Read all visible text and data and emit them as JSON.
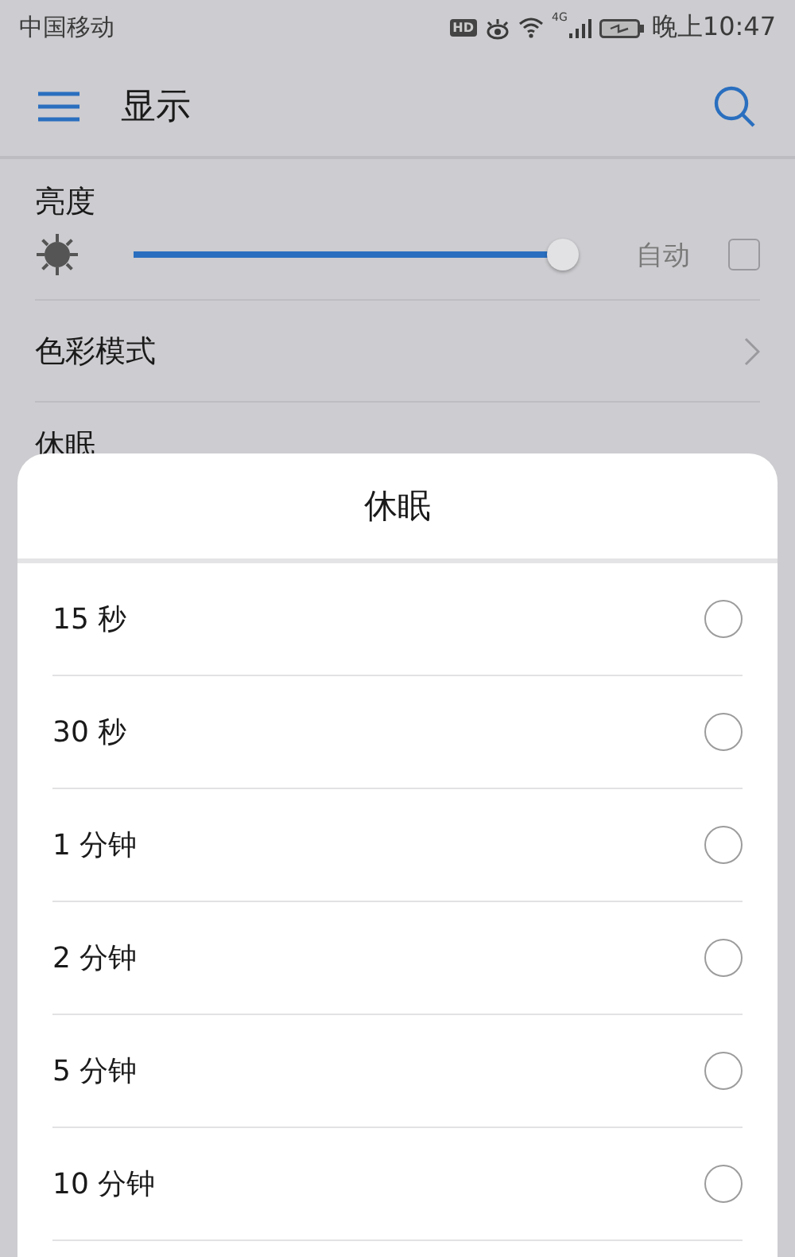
{
  "status_bar": {
    "carrier": "中国移动",
    "hd_badge": "HD",
    "network": "4G",
    "time": "晚上10:47"
  },
  "header": {
    "title": "显示"
  },
  "settings": {
    "brightness": {
      "label": "亮度",
      "level": 0.98,
      "auto_label": "自动",
      "auto_checked": false
    },
    "items": [
      {
        "label": "色彩模式"
      }
    ],
    "partial_item": "休眠"
  },
  "sheet": {
    "title": "休眠",
    "options": [
      {
        "label": "15 秒",
        "selected": false
      },
      {
        "label": "30 秒",
        "selected": false
      },
      {
        "label": "1 分钟",
        "selected": false
      },
      {
        "label": "2 分钟",
        "selected": false
      },
      {
        "label": "5 分钟",
        "selected": false
      },
      {
        "label": "10 分钟",
        "selected": false
      }
    ]
  }
}
